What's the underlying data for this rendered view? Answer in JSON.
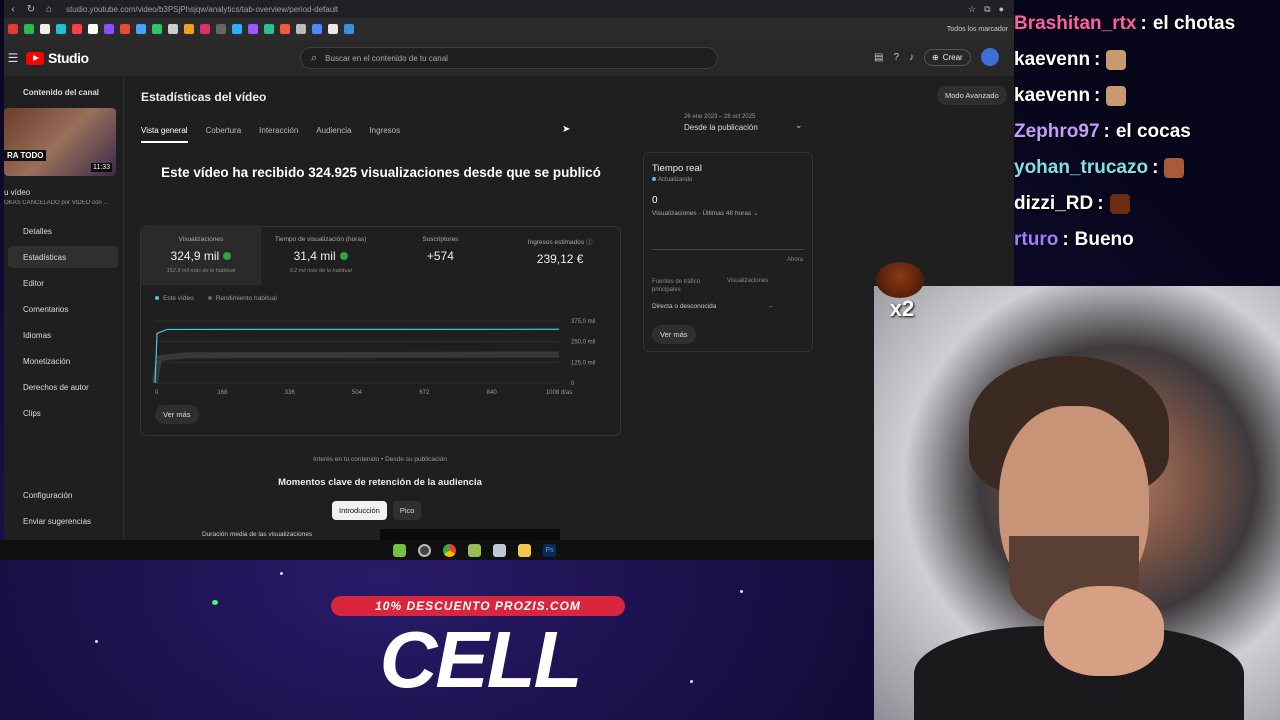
{
  "browser": {
    "url": "studio.youtube.com/video/b3PSjPhsjqw/analytics/tab-overview/period-default",
    "bookmarks_label": "Todos los marcador"
  },
  "header": {
    "logo_text": "Studio",
    "search_placeholder": "Buscar en el contenido de tu canal",
    "create_label": "Crear"
  },
  "sidebar": {
    "title": "Contenido del canal",
    "thumb_tag": "RA TODO",
    "thumb_duration": "11:33",
    "video_label": "u vídeo",
    "video_sub": "OKAS CANCELADO por VÍDEO con ...",
    "items": [
      {
        "label": "Detalles",
        "icon": "pencil-icon"
      },
      {
        "label": "Estadísticas",
        "icon": "chart-icon",
        "active": true
      },
      {
        "label": "Editor",
        "icon": "film-icon"
      },
      {
        "label": "Comentarios",
        "icon": "comment-icon"
      },
      {
        "label": "Idiomas",
        "icon": "translate-icon"
      },
      {
        "label": "Monetización",
        "icon": "dollar-icon"
      },
      {
        "label": "Derechos de autor",
        "icon": "copyright-icon"
      },
      {
        "label": "Clips",
        "icon": "scissors-icon"
      }
    ],
    "bottom_items": [
      {
        "label": "Configuración",
        "icon": "gear-icon"
      },
      {
        "label": "Enviar sugerencias",
        "icon": "feedback-icon"
      }
    ]
  },
  "main": {
    "title": "Estadísticas del vídeo",
    "advanced_button": "Modo Avanzado",
    "tabs": [
      {
        "label": "Vista general",
        "active": true
      },
      {
        "label": "Cobertura"
      },
      {
        "label": "Interacción"
      },
      {
        "label": "Audiencia"
      },
      {
        "label": "Ingresos"
      }
    ],
    "date_range_dates": "26 ene 2023 – 28 oct 2025",
    "date_range_label": "Desde la publicación",
    "headline": "Este vídeo ha recibido 324.925 visualizaciones desde que se publicó",
    "metrics": [
      {
        "label": "Visualizaciones",
        "value": "324,9 mil",
        "sub": "152,9 mil más de lo habitual",
        "check": true,
        "active": true
      },
      {
        "label": "Tiempo de visualización (horas)",
        "value": "31,4 mil",
        "sub": "9,2 mil más de lo habitual",
        "check": true
      },
      {
        "label": "Suscriptores",
        "value": "+574",
        "sub": ""
      },
      {
        "label": "Ingresos estimados",
        "value": "239,12 €",
        "sub": ""
      }
    ],
    "legend": {
      "this_video": "Este vídeo",
      "typical": "Rendimiento habitual"
    },
    "see_more": "Ver más",
    "interest_line": "Interés en tu contenido • Desde su publicación",
    "moments_title": "Momentos clave de retención de la audiencia",
    "pills": [
      {
        "label": "Introducción",
        "active": true
      },
      {
        "label": "Pico"
      }
    ],
    "avg_duration_label": "Duración media de las visualizaciones"
  },
  "realtime": {
    "title": "Tiempo real",
    "status": "Actualizando",
    "value": "0",
    "subtitle": "Visualizaciones · Últimas 48 horas",
    "now_label": "Ahora",
    "col_sources": "Fuentes de tráfico principales",
    "col_views": "Visualizaciones",
    "row_label": "Directa o desconocida",
    "row_value": "–",
    "see_more": "Ver más"
  },
  "chart_data": {
    "type": "line",
    "x": [
      0,
      168,
      336,
      504,
      672,
      840,
      1008
    ],
    "x_tick_labels": [
      "0",
      "168",
      "336",
      "504",
      "672",
      "840",
      "1008 días"
    ],
    "y_tick_labels": [
      "0",
      "125,0 mil",
      "250,0 mil",
      "375,0 mil"
    ],
    "ylim": [
      0,
      375000
    ],
    "series": [
      {
        "name": "Este vídeo",
        "color": "#4ec3e0",
        "points": [
          [
            0,
            0
          ],
          [
            5,
            300000
          ],
          [
            30,
            324000
          ],
          [
            1008,
            324925
          ]
        ]
      },
      {
        "name": "Rendimiento habitual",
        "color": "#666666",
        "points": [
          [
            0,
            0
          ],
          [
            10,
            150000
          ],
          [
            80,
            168000
          ],
          [
            1008,
            172000
          ]
        ]
      }
    ],
    "grid": true
  },
  "chat": [
    {
      "user": "Brashitan_rtx",
      "color": "#ff5fa8",
      "message": "el chotas",
      "emote": false
    },
    {
      "user": "kaevenn",
      "color": "#ffffff",
      "message": "",
      "emote": true,
      "emote_color": "#c99a6f"
    },
    {
      "user": "kaevenn",
      "color": "#ffffff",
      "message": "",
      "emote": true,
      "emote_color": "#c99a6f"
    },
    {
      "user": "Zephro97",
      "color": "#c79bff",
      "message": "el cocas",
      "emote": false
    },
    {
      "user": "yohan_trucazo",
      "color": "#7fe0e8",
      "message": "",
      "emote": true,
      "emote_color": "#a85a3c"
    },
    {
      "user": "dizzi_RD",
      "color": "#ffffff",
      "message": "",
      "emote": true,
      "emote_color": "#6b2c12"
    },
    {
      "user": "rturo",
      "color": "#a07cff",
      "message": "Bueno",
      "emote": false
    }
  ],
  "combo_text": "x2",
  "sponsor": {
    "pill": "10% DESCUENTO PROZIS.COM",
    "big": "CELL"
  }
}
